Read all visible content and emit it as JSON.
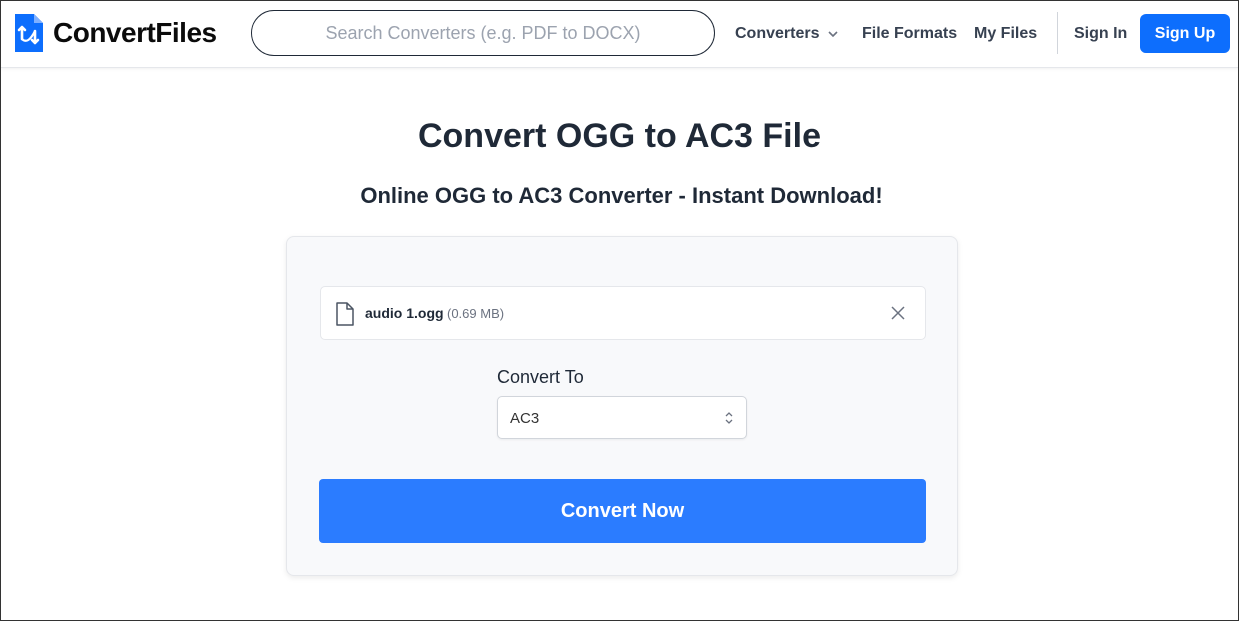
{
  "brand": {
    "name": "ConvertFiles",
    "accent_color": "#0d6efd",
    "icon": "document-convert-logo-icon"
  },
  "search": {
    "placeholder": "Search Converters (e.g. PDF to DOCX)",
    "value": ""
  },
  "nav": {
    "converters_label": "Converters",
    "converters_icon": "chevron-down-icon",
    "file_formats_label": "File Formats",
    "my_files_label": "My Files",
    "sign_in_label": "Sign In",
    "sign_up_label": "Sign Up"
  },
  "main": {
    "title": "Convert OGG to AC3 File",
    "subtitle": "Online OGG to AC3 Converter - Instant Download!"
  },
  "file": {
    "name": "audio 1.ogg",
    "size": "(0.69 MB)",
    "icon": "file-icon",
    "remove_icon": "close-icon"
  },
  "convert": {
    "label": "Convert To",
    "selected_format": "AC3",
    "select_icon": "up-down-arrows-icon",
    "button_label": "Convert Now",
    "button_color": "#2b7cff"
  }
}
